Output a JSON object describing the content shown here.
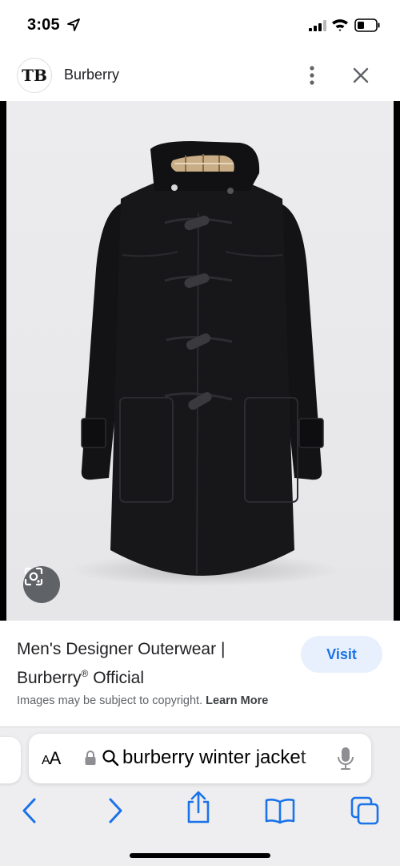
{
  "status_bar": {
    "time": "3:05"
  },
  "header": {
    "brand_logo": "TB",
    "site_name": "Burberry"
  },
  "image": {
    "subject": "black duffle coat with hood and toggle fastenings",
    "lens_icon": "lens-icon"
  },
  "result": {
    "title_line1": "Men's Designer Outerwear |",
    "title_line2_pre": "Burberry",
    "title_line2_sup": "®",
    "title_line2_post": " Official",
    "visit_label": "Visit",
    "copyright_text": "Images may be subject to copyright. ",
    "learn_more": "Learn More"
  },
  "browser": {
    "aa_small": "A",
    "aa_large": "A",
    "url_text": "burberry winter jacket"
  },
  "colors": {
    "accent": "#1a73e8",
    "visit_bg": "#e8f0fe",
    "toolbar_bg": "#eeeef0"
  }
}
